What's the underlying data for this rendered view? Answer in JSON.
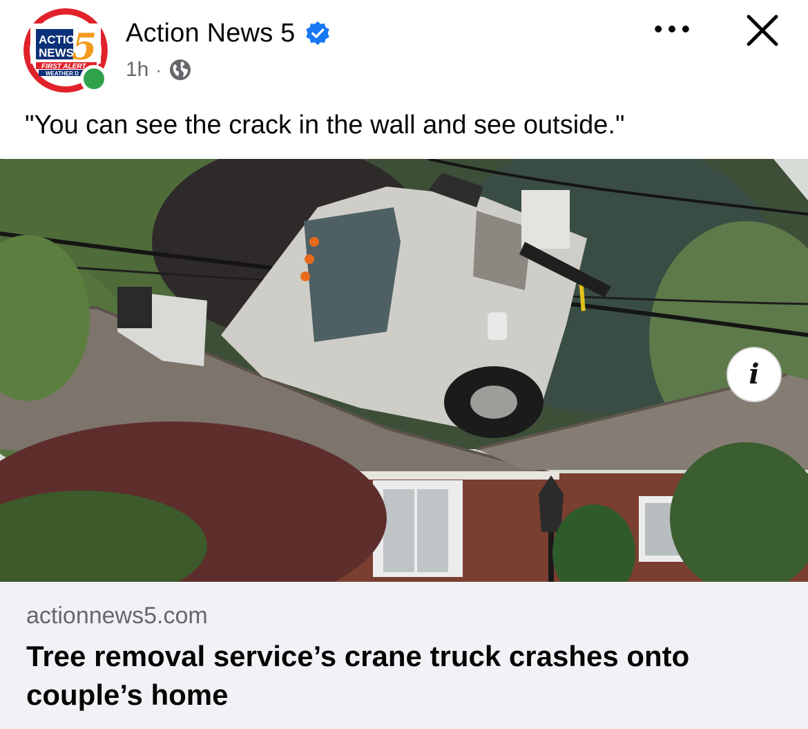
{
  "post": {
    "page_name": "Action News 5",
    "time": "1h",
    "separator": "·",
    "audience_icon": "globe-icon",
    "text": "\"You can see the crack in the wall and see outside.\"",
    "verified_icon": "verified-badge-icon",
    "more_icon": "more-options-icon",
    "close_icon": "close-icon"
  },
  "avatar": {
    "logo_line1": "ACTION",
    "logo_line2": "NEWS",
    "logo_number": "5",
    "logo_banner": "FIRST ALERT",
    "logo_sub": "WEATHER D",
    "colors": {
      "ring": "#e0222a",
      "navy": "#0b2f78",
      "orange": "#f39a1e"
    }
  },
  "media": {
    "info_label": "i"
  },
  "link": {
    "domain": "actionnews5.com",
    "title": "Tree removal service’s crane truck crashes onto couple’s home"
  },
  "colors": {
    "verified": "#1877f2",
    "online": "#31a24c",
    "secondary_text": "#65676b",
    "card_bg": "#f0f2f5"
  }
}
